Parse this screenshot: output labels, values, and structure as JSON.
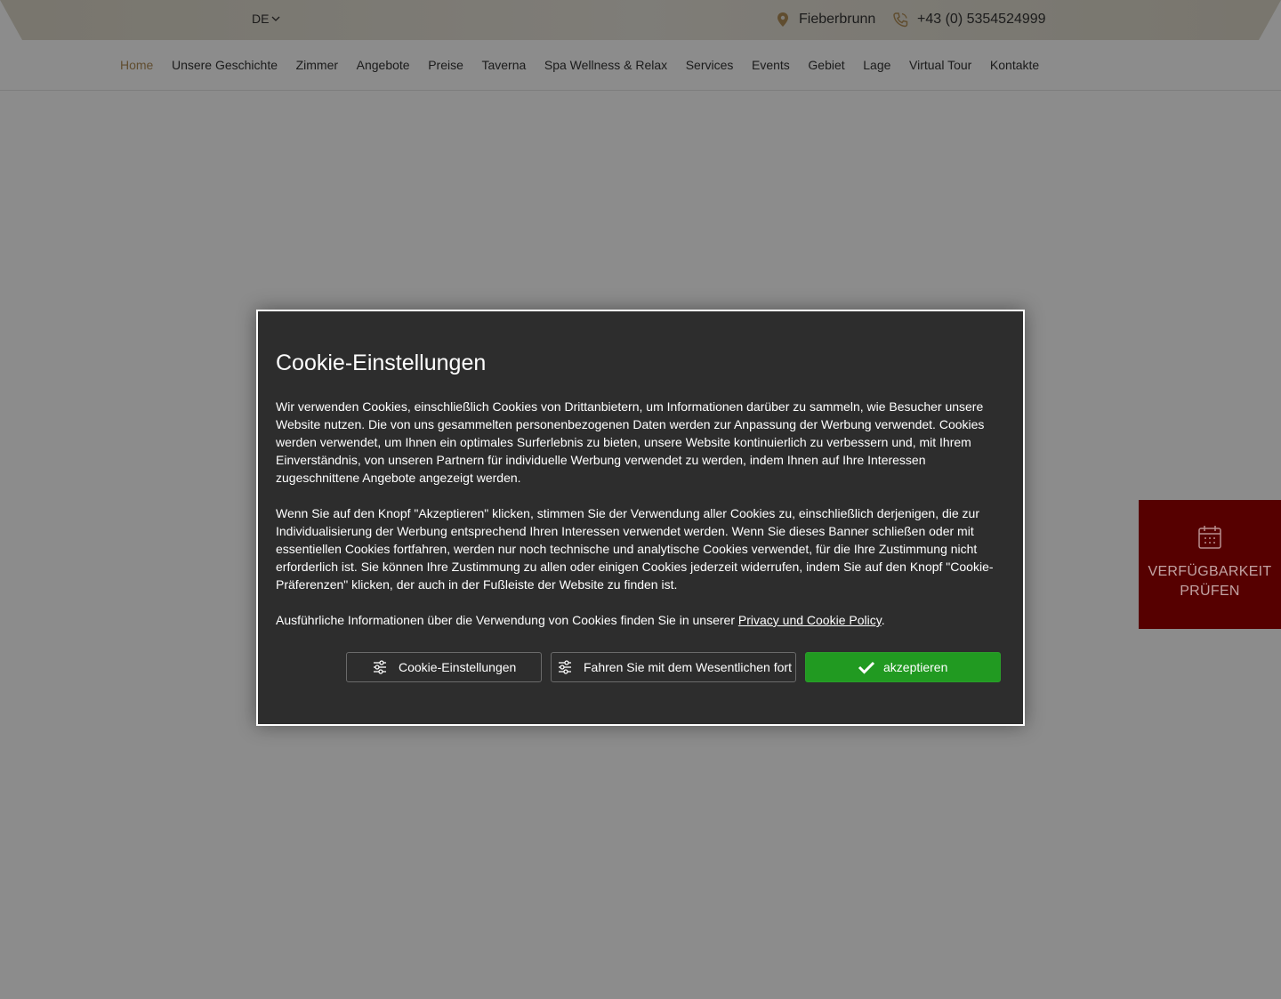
{
  "topbar": {
    "language": "DE",
    "location": "Fieberbrunn",
    "phone": "+43 (0) 5354524999",
    "accent_color": "#b08d57"
  },
  "nav": {
    "items": [
      {
        "label": "Home",
        "active": true
      },
      {
        "label": "Unsere Geschichte"
      },
      {
        "label": "Zimmer"
      },
      {
        "label": "Angebote"
      },
      {
        "label": "Preise"
      },
      {
        "label": "Taverna"
      },
      {
        "label": "Spa Wellness & Relax"
      },
      {
        "label": "Services"
      },
      {
        "label": "Events"
      },
      {
        "label": "Gebiet"
      },
      {
        "label": "Lage"
      },
      {
        "label": "Virtual Tour"
      },
      {
        "label": "Kontakte"
      }
    ]
  },
  "side_cta": {
    "label": "VERFÜGBARKEIT PRÜFEN",
    "icon": "calendar-icon",
    "color": "#560000"
  },
  "cookie_modal": {
    "title": "Cookie-Einstellungen",
    "paragraph1": "Wir verwenden Cookies, einschließlich Cookies von Drittanbietern, um Informationen darüber zu sammeln, wie Besucher unsere Website nutzen. Die von uns gesammelten personenbezogenen Daten werden zur Anpassung der Werbung verwendet. Cookies werden verwendet, um Ihnen ein optimales Surferlebnis zu bieten, unsere Website kontinuierlich zu verbessern und, mit Ihrem Einverständnis, von unseren Partnern für individuelle Werbung verwendet zu werden, indem Ihnen auf Ihre Interessen zugeschnittene Angebote angezeigt werden.",
    "paragraph2": "Wenn Sie auf den Knopf \"Akzeptieren\" klicken, stimmen Sie der Verwendung aller Cookies zu, einschließlich derjenigen, die zur Individualisierung der Werbung entsprechend Ihren Interessen verwendet werden. Wenn Sie dieses Banner schließen oder mit essentiellen Cookies fortfahren, werden nur noch technische und analytische Cookies verwendet, für die Ihre Zustimmung nicht erforderlich ist. Sie können Ihre Zustimmung zu allen oder einigen Cookies jederzeit widerrufen, indem Sie auf den Knopf \"Cookie-Präferenzen\" klicken, der auch in der Fußleiste der Website zu finden ist.",
    "paragraph3_prefix": "Ausführliche Informationen über die Verwendung von Cookies finden Sie in unserer ",
    "policy_link": "Privacy und Cookie Policy",
    "paragraph3_suffix": ".",
    "buttons": {
      "settings": "Cookie-Einstellungen",
      "essential": "Fahren Sie mit dem Wesentlichen fort",
      "accept": "akzeptieren"
    },
    "accept_color": "#219a21"
  }
}
